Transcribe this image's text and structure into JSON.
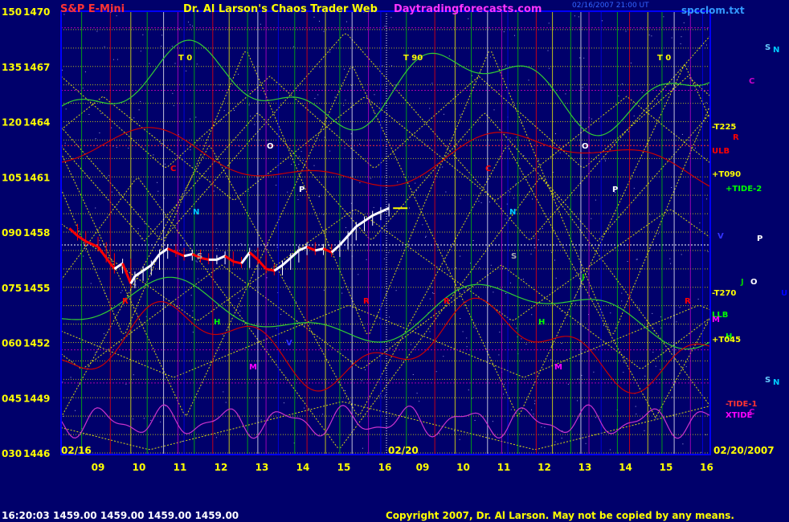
{
  "header": {
    "instrument": "S&P E-Mini",
    "title": "Dr. Al Larson's Chaos Trader Web",
    "site": "Daytradingforecasts.com",
    "stamp": "02/16/2007 21:00 UT",
    "file": "spcclom.txt"
  },
  "footer": {
    "time": "16:20:03",
    "quote": "1459.00 1459.00 1459.00 1459.00",
    "copyright": "Copyright 2007, Dr. Al Larson. May not be copied by any means."
  },
  "chart_data": {
    "type": "line",
    "y_left_ticks": [
      "150",
      "135",
      "120",
      "105",
      "090",
      "075",
      "060",
      "045",
      "030"
    ],
    "y_price_ticks": [
      "1470",
      "1467",
      "1464",
      "1461",
      "1458",
      "1455",
      "1452",
      "1449",
      "1446"
    ],
    "ylim": [
      1446,
      1470
    ],
    "x_ticks_day1": [
      "09",
      "10",
      "11",
      "12",
      "13",
      "14",
      "15",
      "16"
    ],
    "x_ticks_day2": [
      "09",
      "10",
      "11",
      "12",
      "13",
      "14",
      "15",
      "16"
    ],
    "date_labels": [
      "02/16",
      "02/20",
      "02/20/2007"
    ],
    "price_series": {
      "hours": [
        8.3,
        8.5,
        8.7,
        9.0,
        9.2,
        9.4,
        9.6,
        9.8,
        9.9,
        10.1,
        10.3,
        10.5,
        10.7,
        10.9,
        11.1,
        11.3,
        11.5,
        11.7,
        11.9,
        12.1,
        12.3,
        12.5,
        12.7,
        12.9,
        13.1,
        13.3,
        13.5,
        13.7,
        13.9,
        14.1,
        14.3,
        14.5,
        14.7,
        14.9,
        15.1,
        15.3,
        15.5,
        15.7,
        15.9,
        16.1
      ],
      "prices": [
        1458.2,
        1457.8,
        1457.5,
        1457.2,
        1456.6,
        1456.0,
        1456.3,
        1455.2,
        1455.6,
        1455.9,
        1456.2,
        1456.8,
        1457.1,
        1456.9,
        1456.7,
        1456.8,
        1456.6,
        1456.5,
        1456.5,
        1456.7,
        1456.4,
        1456.3,
        1456.9,
        1456.5,
        1456.0,
        1455.9,
        1456.2,
        1456.6,
        1457.0,
        1457.2,
        1457.0,
        1457.1,
        1456.9,
        1457.3,
        1457.8,
        1458.3,
        1458.6,
        1458.9,
        1459.1,
        1459.3
      ]
    },
    "right_labels": [
      {
        "text": "S",
        "color": "#66ccff"
      },
      {
        "text": "N",
        "color": "#00ccff"
      },
      {
        "text": "C",
        "color": "#cc00cc"
      },
      {
        "text": "-T225",
        "color": "#ffff00"
      },
      {
        "text": "R",
        "color": "#ff0000"
      },
      {
        "text": "ULB",
        "color": "#ff0000"
      },
      {
        "text": "+T090",
        "color": "#ffff00"
      },
      {
        "text": "+TIDE-2",
        "color": "#00ff00"
      },
      {
        "text": "V",
        "color": "#3333ff"
      },
      {
        "text": "P",
        "color": "#ffffff"
      },
      {
        "text": "J",
        "color": "#00cc00"
      },
      {
        "text": "O",
        "color": "#ffffff"
      },
      {
        "text": "U",
        "color": "#0000ff"
      },
      {
        "text": "-T270",
        "color": "#ffff00"
      },
      {
        "text": "LLB",
        "color": "#00ff00"
      },
      {
        "text": "M",
        "color": "#ff00ff"
      },
      {
        "text": "H",
        "color": "#00ff00"
      },
      {
        "text": "+T045",
        "color": "#ffff00"
      },
      {
        "text": "S",
        "color": "#66ccff"
      },
      {
        "text": "N",
        "color": "#00ccff"
      },
      {
        "text": "-TIDE-1",
        "color": "#ff3333"
      },
      {
        "text": "XTIDE",
        "color": "#ff00ff"
      },
      {
        "text": "C",
        "color": "#cc00cc"
      }
    ],
    "chart_labels": [
      {
        "text": "T 0",
        "color": "#ffff00"
      },
      {
        "text": "T 90",
        "color": "#ffff00"
      },
      {
        "text": "T 0",
        "color": "#ffff00"
      },
      {
        "text": "O",
        "color": "#ffffff"
      },
      {
        "text": "O",
        "color": "#ffffff"
      },
      {
        "text": "C",
        "color": "#ff0000"
      },
      {
        "text": "C",
        "color": "#ff0000"
      },
      {
        "text": "P",
        "color": "#ffffff"
      },
      {
        "text": "P",
        "color": "#ffffff"
      },
      {
        "text": "N",
        "color": "#00ccff"
      },
      {
        "text": "N",
        "color": "#00ccff"
      },
      {
        "text": "S",
        "color": "#aaaaaa"
      },
      {
        "text": "S",
        "color": "#aaaaaa"
      },
      {
        "text": "H",
        "color": "#00ff00"
      },
      {
        "text": "H",
        "color": "#00ff00"
      },
      {
        "text": "M",
        "color": "#ff00ff"
      },
      {
        "text": "M",
        "color": "#ff00ff"
      },
      {
        "text": "R",
        "color": "#ff0000"
      },
      {
        "text": "R",
        "color": "#ff0000"
      },
      {
        "text": "R",
        "color": "#ff0000"
      },
      {
        "text": "R",
        "color": "#ff0000"
      },
      {
        "text": "V",
        "color": "#3333ff"
      },
      {
        "text": "J",
        "color": "#00cc00"
      }
    ],
    "colors": {
      "background": "#00006b",
      "axis": "#0000ff",
      "grid_h": "#ffff00",
      "grid_v": "#00ff00",
      "price_down": "#ff0000",
      "price_up": "#ffffff",
      "green_flux": "#33cc33",
      "red_flux": "#cc0000",
      "tide": "#cc33cc"
    }
  }
}
